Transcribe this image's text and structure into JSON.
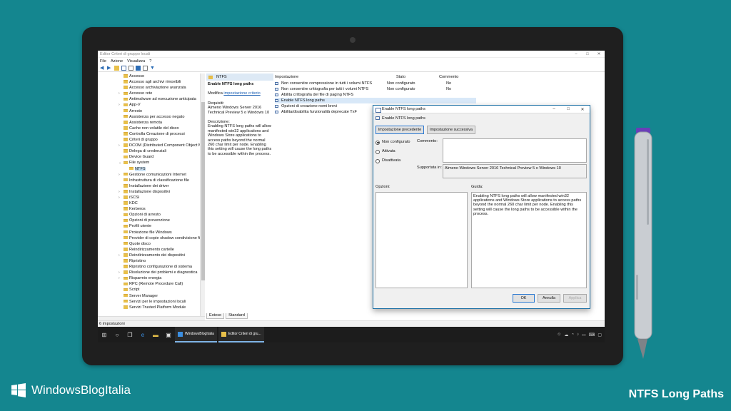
{
  "window": {
    "title": "Editor Criteri di gruppo locali",
    "menu": [
      "File",
      "Azione",
      "Visualizza",
      "?"
    ]
  },
  "tree": {
    "items": [
      {
        "label": "Accesso",
        "arrow": ""
      },
      {
        "label": "Accesso agli archivi rimovibili",
        "arrow": ""
      },
      {
        "label": "Accesso archiviazione avanzata",
        "arrow": ""
      },
      {
        "label": "Accesso rete",
        "arrow": ">"
      },
      {
        "label": "Antimalware ad esecuzione anticipata",
        "arrow": ""
      },
      {
        "label": "App-V",
        "arrow": ">"
      },
      {
        "label": "Arresto",
        "arrow": ""
      },
      {
        "label": "Assistenza per accesso negato",
        "arrow": ""
      },
      {
        "label": "Assistenza remota",
        "arrow": ""
      },
      {
        "label": "Cache non volatile del disco",
        "arrow": ""
      },
      {
        "label": "Controlla Creazione di processi",
        "arrow": ""
      },
      {
        "label": "Criteri di gruppo",
        "arrow": ""
      },
      {
        "label": "DCOM (Distributed Component Object M",
        "arrow": ">"
      },
      {
        "label": "Delega di credenziali",
        "arrow": ""
      },
      {
        "label": "Device Guard",
        "arrow": ""
      },
      {
        "label": "File system",
        "arrow": "v"
      },
      {
        "label": "NTFS",
        "arrow": "",
        "sub": true,
        "selected": true
      },
      {
        "label": "Gestione comunicazioni Internet",
        "arrow": ">"
      },
      {
        "label": "Infrastruttura di classificazione file",
        "arrow": ""
      },
      {
        "label": "Installazione dei driver",
        "arrow": ""
      },
      {
        "label": "Installazione dispositivi",
        "arrow": ">"
      },
      {
        "label": "iSCSI",
        "arrow": ">"
      },
      {
        "label": "KDC",
        "arrow": ""
      },
      {
        "label": "Kerberos",
        "arrow": ""
      },
      {
        "label": "Opzioni di arresto",
        "arrow": ""
      },
      {
        "label": "Opzioni di prevenzione",
        "arrow": ""
      },
      {
        "label": "Profili utente",
        "arrow": ""
      },
      {
        "label": "Protezione file Windows",
        "arrow": ""
      },
      {
        "label": "Provider di copie shadow condivisione file",
        "arrow": ""
      },
      {
        "label": "Quote disco",
        "arrow": ""
      },
      {
        "label": "Reindirizzamento cartelle",
        "arrow": ""
      },
      {
        "label": "Reindirizzamento dei dispositivi",
        "arrow": ">"
      },
      {
        "label": "Ripristino",
        "arrow": ""
      },
      {
        "label": "Ripristino configurazione di sistema",
        "arrow": ""
      },
      {
        "label": "Risoluzione dei problemi e diagnostica",
        "arrow": ">"
      },
      {
        "label": "Risparmio energia",
        "arrow": ">"
      },
      {
        "label": "RPC (Remote Procedure Call)",
        "arrow": ""
      },
      {
        "label": "Script",
        "arrow": ""
      },
      {
        "label": "Server Manager",
        "arrow": ""
      },
      {
        "label": "Servizi per le impostazioni locali",
        "arrow": ""
      },
      {
        "label": "Servizi Trusted Platform Module",
        "arrow": ""
      }
    ]
  },
  "description": {
    "folder": "NTFS",
    "heading": "Enable NTFS long paths",
    "modify_prefix": "Modifica",
    "modify_link": "impostazione criterio",
    "requisiti_label": "Requisiti:",
    "requisiti_text": "Almeno Windows Server 2016 Technical Preview 5 o Windows 10",
    "descrizione_label": "Descrizione:",
    "descrizione_text": "Enabling NTFS long paths will allow manifested win32 applications and Windows Store applications to access paths beyond the normal 260 char limit per node. Enabling this setting will cause the long paths to be accessible within the process."
  },
  "settings_list": {
    "headers": {
      "name": "Impostazione",
      "state": "Stato",
      "comment": "Commento"
    },
    "rows": [
      {
        "name": "Non consentire compressione in tutti i volumi NTFS",
        "state": "Non configurato",
        "comment": "No"
      },
      {
        "name": "Non consentire crittografia per tutti i volumi NTFS",
        "state": "Non configurato",
        "comment": "No"
      },
      {
        "name": "Abilita crittografia del file di paging NTFS",
        "state": "",
        "comment": ""
      },
      {
        "name": "Enable NTFS long paths",
        "state": "",
        "comment": "",
        "selected": true
      },
      {
        "name": "Opzioni di creazione nomi brevi",
        "state": "",
        "comment": ""
      },
      {
        "name": "Abilita/disabilita funzionalità deprecate TxF",
        "state": "",
        "comment": ""
      }
    ]
  },
  "tabs": [
    "Esteso",
    "Standard"
  ],
  "status": "6 impostazioni",
  "taskbar": {
    "apps": [
      "WindowsBlogItalia",
      "Editor Criteri di gru..."
    ]
  },
  "dialog": {
    "title": "Enable NTFS long paths",
    "subtitle": "Enable NTFS long paths",
    "prev_button": "Impostazione precedente",
    "next_button": "Impostazione successiva",
    "radio_not_configured": "Non configurato",
    "radio_enabled": "Attivata",
    "radio_disabled": "Disattivata",
    "selected_option": "Non configurato",
    "comment_label": "Commento:",
    "supported_label": "Supportata in:",
    "supported_value": "Almeno Windows Server 2016 Technical Preview 5 o Windows 10",
    "options_label": "Opzioni:",
    "help_label": "Guida:",
    "help_text": "Enabling NTFS long paths will allow manifested win32 applications and Windows Store applications to access paths beyond the normal 260 char limit per node. Enabling this setting will cause the long paths to be accessible within the process.",
    "ok": "OK",
    "cancel": "Annulla",
    "apply": "Applica"
  },
  "branding": {
    "logo_text": "WindowsBlogItalia",
    "caption": "NTFS Long Paths"
  }
}
